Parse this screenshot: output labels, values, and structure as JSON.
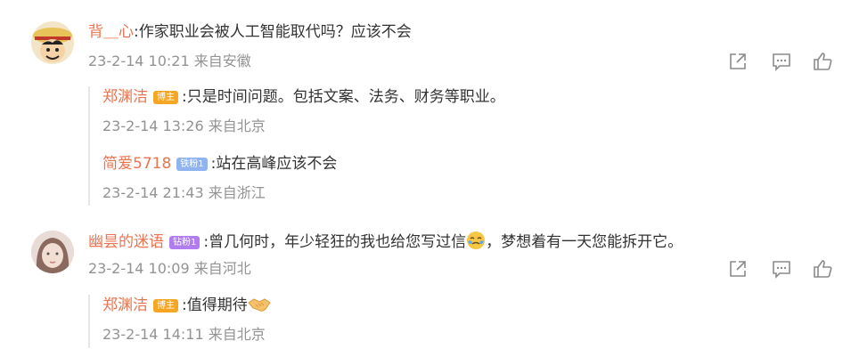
{
  "comments": [
    {
      "user": "背＿心",
      "text": ":作家职业会被人工智能取代吗？应该不会",
      "time": "23-2-14 10:21 来自安徽",
      "replies": [
        {
          "user": "郑渊洁",
          "badge": "博主",
          "text": ":只是时间问题。包括文案、法务、财务等职业。",
          "time": "23-2-14 13:26 来自北京"
        },
        {
          "user": "简爱5718",
          "badge": "铁粉1",
          "text": ":站在高峰应该不会",
          "time": "23-2-14 21:43 来自浙江"
        }
      ]
    },
    {
      "user": "幽昙的迷语",
      "badge": "钻粉1",
      "text_before": ":曾几何时，年少轻狂的我也给您写过信",
      "text_after": "，梦想着有一天您能拆开它。",
      "time": "23-2-14 10:09 来自河北",
      "replies": [
        {
          "user": "郑渊洁",
          "badge": "博主",
          "text": ":值得期待",
          "time": "23-2-14 14:11 来自北京"
        }
      ]
    }
  ],
  "icons": {
    "share": "share-icon",
    "comment": "comment-icon",
    "like": "like-icon",
    "crying": "crying-emoji-icon",
    "handshake": "handshake-emoji-icon"
  },
  "colors": {
    "name": "#eb7350",
    "meta": "#939393",
    "host_badge": "#f5a623",
    "iron_badge": "#8fb4f0",
    "diamond_badge": "#b07cf0"
  }
}
